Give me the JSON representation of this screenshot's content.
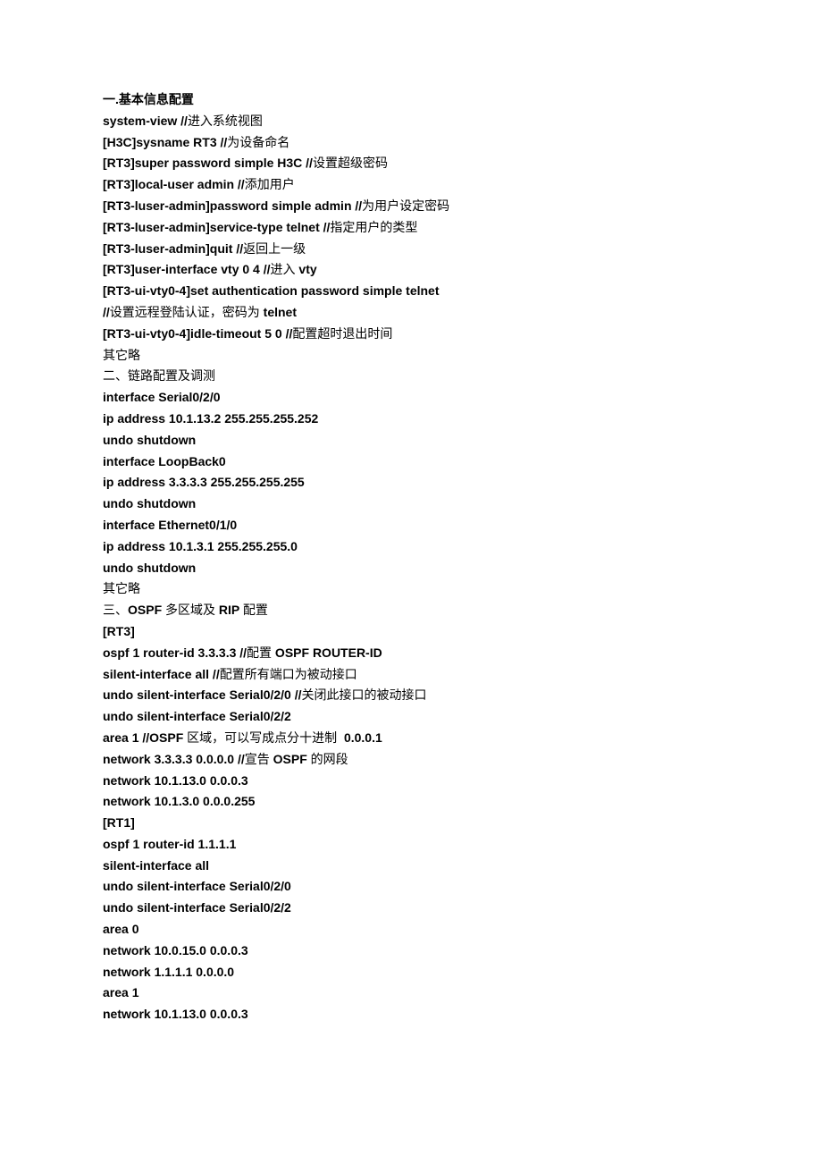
{
  "lines": [
    {
      "parts": [
        {
          "bold": true,
          "text": "一."
        },
        {
          "bold": true,
          "text": "基本信息配置"
        }
      ]
    },
    {
      "parts": [
        {
          "bold": true,
          "text": "system-view //"
        },
        {
          "bold": false,
          "text": "进入系统视图"
        }
      ]
    },
    {
      "parts": [
        {
          "bold": true,
          "text": "[H3C]sysname RT3 //"
        },
        {
          "bold": false,
          "text": "为设备命名"
        }
      ]
    },
    {
      "parts": [
        {
          "bold": true,
          "text": "[RT3]super password simple H3C //"
        },
        {
          "bold": false,
          "text": "设置超级密码"
        }
      ]
    },
    {
      "parts": [
        {
          "bold": true,
          "text": "[RT3]local-user admin //"
        },
        {
          "bold": false,
          "text": "添加用户"
        }
      ]
    },
    {
      "parts": [
        {
          "bold": true,
          "text": "[RT3-luser-admin]password simple admin //"
        },
        {
          "bold": false,
          "text": "为用户设定密码"
        }
      ]
    },
    {
      "parts": [
        {
          "bold": true,
          "text": "[RT3-luser-admin]service-type telnet //"
        },
        {
          "bold": false,
          "text": "指定用户的类型"
        }
      ]
    },
    {
      "parts": [
        {
          "bold": true,
          "text": "[RT3-luser-admin]quit //"
        },
        {
          "bold": false,
          "text": "返回上一级"
        }
      ]
    },
    {
      "parts": [
        {
          "bold": true,
          "text": "[RT3]user-interface vty 0 4 //"
        },
        {
          "bold": false,
          "text": "进入"
        },
        {
          "bold": true,
          "text": " vty"
        }
      ]
    },
    {
      "parts": [
        {
          "bold": true,
          "text": "[RT3-ui-vty0-4]set authentication password simple telnet"
        }
      ]
    },
    {
      "parts": [
        {
          "bold": true,
          "text": "//"
        },
        {
          "bold": false,
          "text": "设置远程登陆认证，密码为"
        },
        {
          "bold": true,
          "text": " telnet"
        }
      ]
    },
    {
      "parts": [
        {
          "bold": true,
          "text": "[RT3-ui-vty0-4]idle-timeout 5 0 //"
        },
        {
          "bold": false,
          "text": "配置超时退出时间"
        }
      ]
    },
    {
      "parts": [
        {
          "bold": false,
          "text": "其它略"
        }
      ]
    },
    {
      "parts": [
        {
          "bold": false,
          "text": "二、链路配置及调测"
        }
      ]
    },
    {
      "parts": [
        {
          "bold": true,
          "text": "interface Serial0/2/0"
        }
      ]
    },
    {
      "parts": [
        {
          "bold": true,
          "text": "ip address 10.1.13.2 255.255.255.252"
        }
      ]
    },
    {
      "parts": [
        {
          "bold": true,
          "text": "undo shutdown"
        }
      ]
    },
    {
      "parts": [
        {
          "bold": true,
          "text": "interface LoopBack0"
        }
      ]
    },
    {
      "parts": [
        {
          "bold": true,
          "text": "ip address 3.3.3.3 255.255.255.255"
        }
      ]
    },
    {
      "parts": [
        {
          "bold": true,
          "text": "undo shutdown"
        }
      ]
    },
    {
      "parts": [
        {
          "bold": true,
          "text": "interface Ethernet0/1/0"
        }
      ]
    },
    {
      "parts": [
        {
          "bold": true,
          "text": "ip address 10.1.3.1 255.255.255.0"
        }
      ]
    },
    {
      "parts": [
        {
          "bold": true,
          "text": "undo shutdown"
        }
      ]
    },
    {
      "parts": [
        {
          "bold": false,
          "text": "其它略"
        }
      ]
    },
    {
      "parts": [
        {
          "bold": false,
          "text": "三、"
        },
        {
          "bold": true,
          "text": "OSPF "
        },
        {
          "bold": false,
          "text": "多区域及"
        },
        {
          "bold": true,
          "text": " RIP "
        },
        {
          "bold": false,
          "text": "配置"
        }
      ]
    },
    {
      "parts": [
        {
          "bold": true,
          "text": "[RT3]"
        }
      ]
    },
    {
      "parts": [
        {
          "bold": true,
          "text": "ospf 1 router-id 3.3.3.3 //"
        },
        {
          "bold": false,
          "text": "配置"
        },
        {
          "bold": true,
          "text": " OSPF ROUTER-ID"
        }
      ]
    },
    {
      "parts": [
        {
          "bold": true,
          "text": "silent-interface all //"
        },
        {
          "bold": false,
          "text": "配置所有端口为被动接口"
        }
      ]
    },
    {
      "parts": [
        {
          "bold": true,
          "text": "undo silent-interface Serial0/2/0 //"
        },
        {
          "bold": false,
          "text": "关闭此接口的被动接口"
        }
      ]
    },
    {
      "parts": [
        {
          "bold": true,
          "text": "undo silent-interface Serial0/2/2"
        }
      ]
    },
    {
      "parts": [
        {
          "bold": true,
          "text": "area 1 //OSPF "
        },
        {
          "bold": false,
          "text": "区域，可以写成点分十进制"
        },
        {
          "bold": true,
          "text": "  0.0.0.1"
        }
      ]
    },
    {
      "parts": [
        {
          "bold": true,
          "text": "network 3.3.3.3 0.0.0.0 //"
        },
        {
          "bold": false,
          "text": "宣告"
        },
        {
          "bold": true,
          "text": " OSPF "
        },
        {
          "bold": false,
          "text": "的网段"
        }
      ]
    },
    {
      "parts": [
        {
          "bold": true,
          "text": "network 10.1.13.0 0.0.0.3"
        }
      ]
    },
    {
      "parts": [
        {
          "bold": true,
          "text": "network 10.1.3.0 0.0.0.255"
        }
      ]
    },
    {
      "parts": [
        {
          "bold": true,
          "text": "[RT1]"
        }
      ]
    },
    {
      "parts": [
        {
          "bold": true,
          "text": "ospf 1 router-id 1.1.1.1"
        }
      ]
    },
    {
      "parts": [
        {
          "bold": true,
          "text": "silent-interface all"
        }
      ]
    },
    {
      "parts": [
        {
          "bold": true,
          "text": "undo silent-interface Serial0/2/0"
        }
      ]
    },
    {
      "parts": [
        {
          "bold": true,
          "text": "undo silent-interface Serial0/2/2"
        }
      ]
    },
    {
      "parts": [
        {
          "bold": true,
          "text": "area 0"
        }
      ]
    },
    {
      "parts": [
        {
          "bold": true,
          "text": "network 10.0.15.0 0.0.0.3"
        }
      ]
    },
    {
      "parts": [
        {
          "bold": true,
          "text": "network 1.1.1.1 0.0.0.0"
        }
      ]
    },
    {
      "parts": [
        {
          "bold": true,
          "text": "area 1"
        }
      ]
    },
    {
      "parts": [
        {
          "bold": true,
          "text": "network 10.1.13.0 0.0.0.3"
        }
      ]
    }
  ]
}
